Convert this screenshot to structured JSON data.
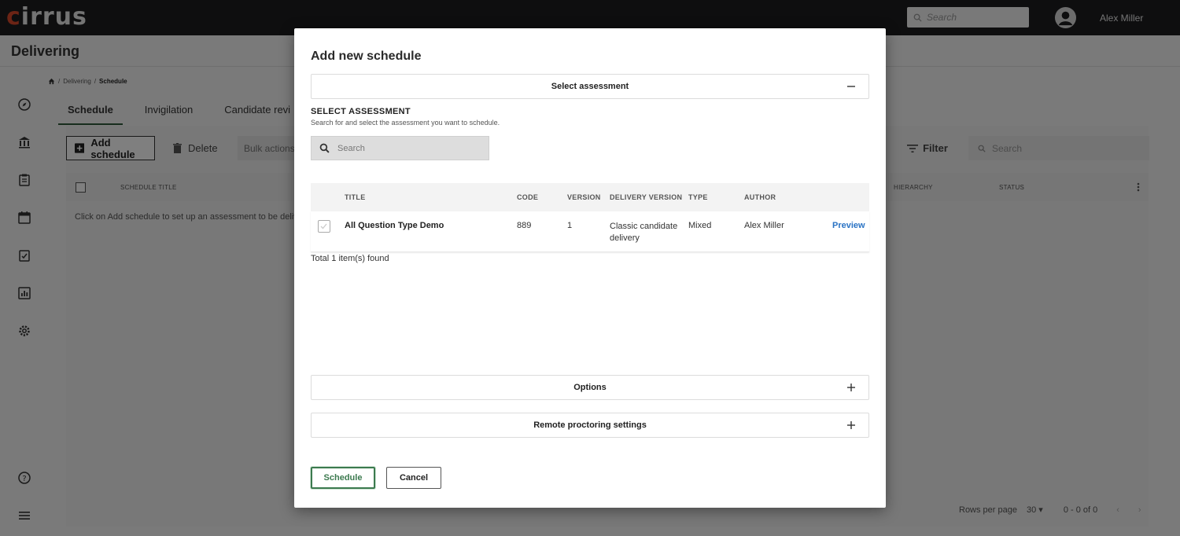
{
  "app": {
    "logo_text": "cirrus",
    "top_search_placeholder": "Search",
    "user_name": "Alex Miller",
    "page_title": "Delivering"
  },
  "breadcrumb": [
    "Delivering",
    "Schedule"
  ],
  "tabs": [
    "Schedule",
    "Invigilation",
    "Candidate revi"
  ],
  "toolbar": {
    "add_label": "Add schedule",
    "delete_label": "Delete",
    "bulk_label": "Bulk actions",
    "filter_label": "Filter",
    "search_placeholder": "Search"
  },
  "grid": {
    "headers": {
      "title": "SCHEDULE TITLE",
      "hierarchy": "HIERARCHY",
      "status": "STATUS"
    },
    "empty_text": "Click on Add schedule to set up an assessment to be deliver"
  },
  "pager": {
    "rows_label": "Rows per page",
    "rows_value": "30",
    "range": "0 - 0 of 0"
  },
  "modal": {
    "title": "Add new schedule",
    "section_select": "Select assessment",
    "select_label": "SELECT ASSESSMENT",
    "select_desc": "Search for and select the assessment you want to schedule.",
    "search_placeholder": "Search",
    "columns": {
      "title": "TITLE",
      "code": "CODE",
      "version": "VERSION",
      "delivery": "DELIVERY VERSION",
      "type": "TYPE",
      "author": "AUTHOR"
    },
    "rows": [
      {
        "title": "All Question Type Demo",
        "code": "889",
        "version": "1",
        "delivery": "Classic candidate delivery",
        "type": "Mixed",
        "author": "Alex Miller",
        "action": "Preview"
      }
    ],
    "found_text": "Total 1 item(s) found",
    "section_options": "Options",
    "section_remote": "Remote proctoring settings",
    "schedule_label": "Schedule",
    "cancel_label": "Cancel"
  },
  "colors": {
    "accent_green": "#3c7a4f",
    "link_blue": "#2a73c4",
    "topbar": "#1c1c1f"
  }
}
